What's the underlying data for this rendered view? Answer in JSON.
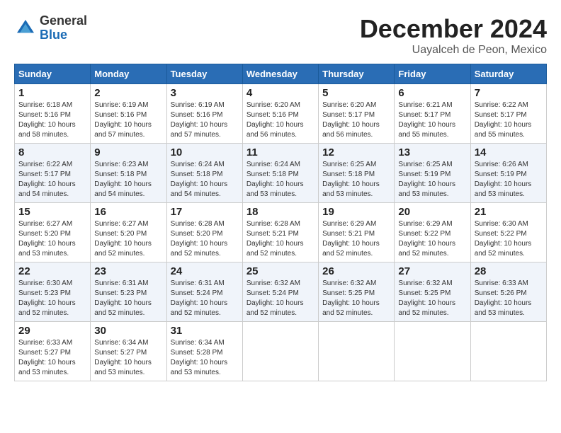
{
  "header": {
    "logo_general": "General",
    "logo_blue": "Blue",
    "month": "December 2024",
    "location": "Uayalceh de Peon, Mexico"
  },
  "days_of_week": [
    "Sunday",
    "Monday",
    "Tuesday",
    "Wednesday",
    "Thursday",
    "Friday",
    "Saturday"
  ],
  "weeks": [
    [
      {
        "day": "1",
        "info": "Sunrise: 6:18 AM\nSunset: 5:16 PM\nDaylight: 10 hours\nand 58 minutes."
      },
      {
        "day": "2",
        "info": "Sunrise: 6:19 AM\nSunset: 5:16 PM\nDaylight: 10 hours\nand 57 minutes."
      },
      {
        "day": "3",
        "info": "Sunrise: 6:19 AM\nSunset: 5:16 PM\nDaylight: 10 hours\nand 57 minutes."
      },
      {
        "day": "4",
        "info": "Sunrise: 6:20 AM\nSunset: 5:16 PM\nDaylight: 10 hours\nand 56 minutes."
      },
      {
        "day": "5",
        "info": "Sunrise: 6:20 AM\nSunset: 5:17 PM\nDaylight: 10 hours\nand 56 minutes."
      },
      {
        "day": "6",
        "info": "Sunrise: 6:21 AM\nSunset: 5:17 PM\nDaylight: 10 hours\nand 55 minutes."
      },
      {
        "day": "7",
        "info": "Sunrise: 6:22 AM\nSunset: 5:17 PM\nDaylight: 10 hours\nand 55 minutes."
      }
    ],
    [
      {
        "day": "8",
        "info": "Sunrise: 6:22 AM\nSunset: 5:17 PM\nDaylight: 10 hours\nand 54 minutes."
      },
      {
        "day": "9",
        "info": "Sunrise: 6:23 AM\nSunset: 5:18 PM\nDaylight: 10 hours\nand 54 minutes."
      },
      {
        "day": "10",
        "info": "Sunrise: 6:24 AM\nSunset: 5:18 PM\nDaylight: 10 hours\nand 54 minutes."
      },
      {
        "day": "11",
        "info": "Sunrise: 6:24 AM\nSunset: 5:18 PM\nDaylight: 10 hours\nand 53 minutes."
      },
      {
        "day": "12",
        "info": "Sunrise: 6:25 AM\nSunset: 5:18 PM\nDaylight: 10 hours\nand 53 minutes."
      },
      {
        "day": "13",
        "info": "Sunrise: 6:25 AM\nSunset: 5:19 PM\nDaylight: 10 hours\nand 53 minutes."
      },
      {
        "day": "14",
        "info": "Sunrise: 6:26 AM\nSunset: 5:19 PM\nDaylight: 10 hours\nand 53 minutes."
      }
    ],
    [
      {
        "day": "15",
        "info": "Sunrise: 6:27 AM\nSunset: 5:20 PM\nDaylight: 10 hours\nand 53 minutes."
      },
      {
        "day": "16",
        "info": "Sunrise: 6:27 AM\nSunset: 5:20 PM\nDaylight: 10 hours\nand 52 minutes."
      },
      {
        "day": "17",
        "info": "Sunrise: 6:28 AM\nSunset: 5:20 PM\nDaylight: 10 hours\nand 52 minutes."
      },
      {
        "day": "18",
        "info": "Sunrise: 6:28 AM\nSunset: 5:21 PM\nDaylight: 10 hours\nand 52 minutes."
      },
      {
        "day": "19",
        "info": "Sunrise: 6:29 AM\nSunset: 5:21 PM\nDaylight: 10 hours\nand 52 minutes."
      },
      {
        "day": "20",
        "info": "Sunrise: 6:29 AM\nSunset: 5:22 PM\nDaylight: 10 hours\nand 52 minutes."
      },
      {
        "day": "21",
        "info": "Sunrise: 6:30 AM\nSunset: 5:22 PM\nDaylight: 10 hours\nand 52 minutes."
      }
    ],
    [
      {
        "day": "22",
        "info": "Sunrise: 6:30 AM\nSunset: 5:23 PM\nDaylight: 10 hours\nand 52 minutes."
      },
      {
        "day": "23",
        "info": "Sunrise: 6:31 AM\nSunset: 5:23 PM\nDaylight: 10 hours\nand 52 minutes."
      },
      {
        "day": "24",
        "info": "Sunrise: 6:31 AM\nSunset: 5:24 PM\nDaylight: 10 hours\nand 52 minutes."
      },
      {
        "day": "25",
        "info": "Sunrise: 6:32 AM\nSunset: 5:24 PM\nDaylight: 10 hours\nand 52 minutes."
      },
      {
        "day": "26",
        "info": "Sunrise: 6:32 AM\nSunset: 5:25 PM\nDaylight: 10 hours\nand 52 minutes."
      },
      {
        "day": "27",
        "info": "Sunrise: 6:32 AM\nSunset: 5:25 PM\nDaylight: 10 hours\nand 52 minutes."
      },
      {
        "day": "28",
        "info": "Sunrise: 6:33 AM\nSunset: 5:26 PM\nDaylight: 10 hours\nand 53 minutes."
      }
    ],
    [
      {
        "day": "29",
        "info": "Sunrise: 6:33 AM\nSunset: 5:27 PM\nDaylight: 10 hours\nand 53 minutes."
      },
      {
        "day": "30",
        "info": "Sunrise: 6:34 AM\nSunset: 5:27 PM\nDaylight: 10 hours\nand 53 minutes."
      },
      {
        "day": "31",
        "info": "Sunrise: 6:34 AM\nSunset: 5:28 PM\nDaylight: 10 hours\nand 53 minutes."
      },
      {
        "day": "",
        "info": ""
      },
      {
        "day": "",
        "info": ""
      },
      {
        "day": "",
        "info": ""
      },
      {
        "day": "",
        "info": ""
      }
    ]
  ]
}
